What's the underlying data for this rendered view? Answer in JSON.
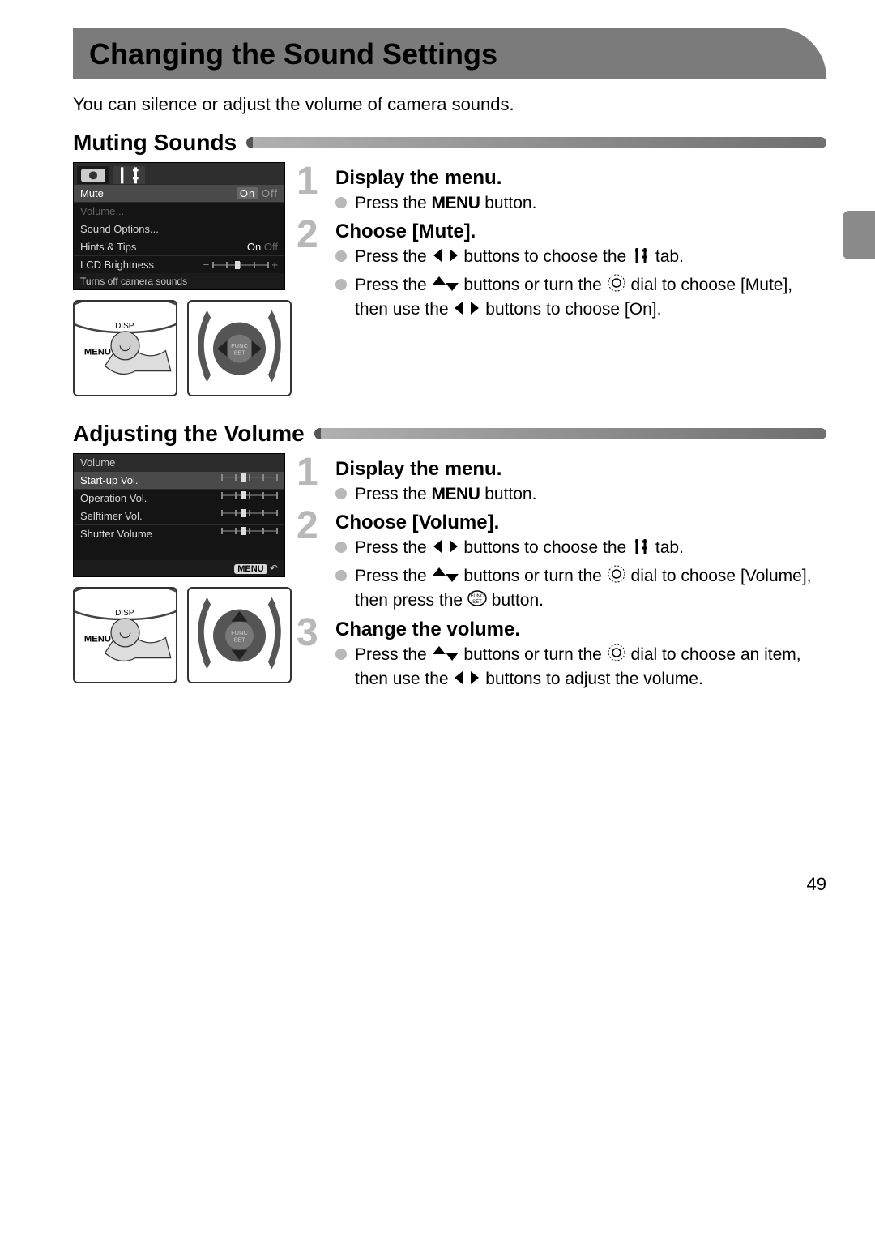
{
  "title": "Changing the Sound Settings",
  "intro": "You can silence or adjust the volume of camera sounds.",
  "section1": {
    "title": "Muting Sounds",
    "lcd": {
      "rows": {
        "mute": {
          "label": "Mute",
          "value_on": "On",
          "value_off": "Off"
        },
        "volume": {
          "label": "Volume..."
        },
        "sound_options": {
          "label": "Sound Options..."
        },
        "hints": {
          "label": "Hints & Tips",
          "value_on": "On",
          "value_off": "Off"
        },
        "brightness": {
          "label": "LCD Brightness",
          "minus": "−",
          "plus": "+"
        }
      },
      "footer": "Turns off camera sounds"
    },
    "step1": {
      "num": "1",
      "title": "Display the menu.",
      "b1a": "Press the ",
      "b1_menu": "MENU",
      "b1b": " button."
    },
    "step2": {
      "num": "2",
      "title": "Choose [Mute].",
      "b1a": "Press the ",
      "b1b": " buttons to choose the ",
      "b1c": " tab.",
      "b2a": "Press the ",
      "b2b": " buttons or turn the ",
      "b2c": " dial to choose [Mute], then use the ",
      "b2d": " buttons to choose [On]."
    }
  },
  "section2": {
    "title": "Adjusting the Volume",
    "lcd": {
      "header": "Volume",
      "rows": {
        "startup": {
          "label": "Start-up Vol."
        },
        "operation": {
          "label": "Operation Vol."
        },
        "selftimer": {
          "label": "Selftimer Vol."
        },
        "shutter": {
          "label": "Shutter Volume"
        }
      },
      "footer_badge": "MENU",
      "footer_arrow": "↶"
    },
    "step1": {
      "num": "1",
      "title": "Display the menu.",
      "b1a": "Press the ",
      "b1_menu": "MENU",
      "b1b": " button."
    },
    "step2": {
      "num": "2",
      "title": "Choose [Volume].",
      "b1a": "Press the ",
      "b1b": " buttons to choose the ",
      "b1c": " tab.",
      "b2a": "Press the ",
      "b2b": " buttons or turn the ",
      "b2c": " dial to choose [Volume], then press the ",
      "b2d": " button."
    },
    "step3": {
      "num": "3",
      "title": "Change the volume.",
      "b1a": "Press the ",
      "b1b": " buttons or turn the ",
      "b1c": " dial to choose an item, then use the ",
      "b1d": " buttons to adjust the volume."
    }
  },
  "page_number": "49"
}
